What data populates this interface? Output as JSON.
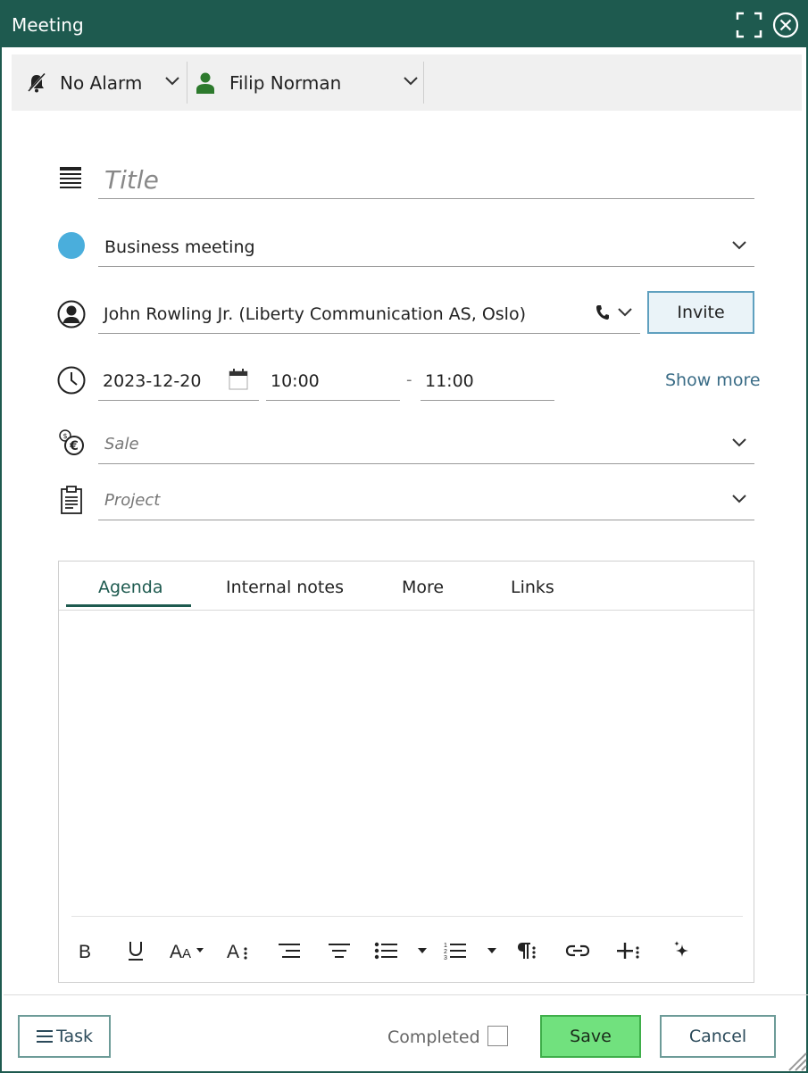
{
  "window": {
    "title": "Meeting"
  },
  "toolbar": {
    "alarm_label": "No Alarm",
    "owner_label": "Filip Norman"
  },
  "form": {
    "title_placeholder": "Title",
    "type_value": "Business meeting",
    "type_color": "#4aaedc",
    "contact_value": "John Rowling Jr. (Liberty Communication AS, Oslo)",
    "invite_label": "Invite",
    "date_value": "2023-12-20",
    "start_time": "10:00",
    "time_sep": "-",
    "end_time": "11:00",
    "show_more_label": "Show more",
    "sale_placeholder": "Sale",
    "project_placeholder": "Project"
  },
  "editor": {
    "tabs": [
      {
        "label": "Agenda",
        "active": true
      },
      {
        "label": "Internal notes"
      },
      {
        "label": "More"
      },
      {
        "label": "Links"
      }
    ],
    "format_icons": [
      "bold-icon",
      "underline-icon",
      "font-size-icon",
      "font-style-icon",
      "align-right-icon",
      "align-center-icon",
      "bullet-list-icon",
      "numbered-list-icon",
      "paragraph-icon",
      "link-icon",
      "insert-icon",
      "ai-sparkle-icon"
    ]
  },
  "footer": {
    "task_label": "Task",
    "completed_label": "Completed",
    "completed_checked": false,
    "save_label": "Save",
    "cancel_label": "Cancel"
  },
  "colors": {
    "brand": "#1e5a4f",
    "save": "#71e17e",
    "link": "#3a6c86"
  }
}
